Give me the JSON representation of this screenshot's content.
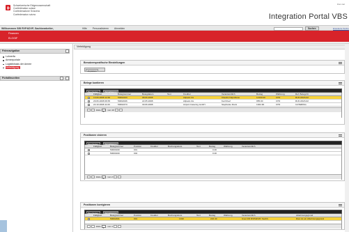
{
  "header": {
    "confederation": [
      "Schweizerische Eidgenossenschaft",
      "Confédération suisse",
      "Confederazione Svizzera",
      "Confederaziun svizra"
    ],
    "toplinks": "Inter-net",
    "portal_title": "Integration Portal VBS"
  },
  "menubar": {
    "welcome": "Willkommen SIB RVP&DVP, Sachbearbeiter,",
    "items": [
      "Hilfe",
      "Personalisieren",
      "Abmelden"
    ],
    "search_button": "Suchen",
    "extended_search": "Erweiterte Suche"
  },
  "tabs": {
    "primary": "Finanzen",
    "secondary": "ELOGIF"
  },
  "left": {
    "nav_header": "Feinnavigation",
    "nav_items": [
      "Lohnerfa",
      "Armeeportale",
      "Logistikbasis der Armee",
      "Verteidigung"
    ],
    "portal_favorites": "Portalfavoriten"
  },
  "main": {
    "title": "Verteidigung",
    "settings_panel": {
      "title": "Benutzerspezifische Einstellungen",
      "button": "Anpassen"
    },
    "belege_panel": {
      "title": "Belege kontieren",
      "toolbar": [
        "Bearbeiten",
        "Aktualisieren"
      ],
      "columns": [
        "Fälligkeit",
        "Belegnummer",
        "Belegdatum",
        "Text",
        "Kreditor",
        "Verantwortlich",
        "Betrag",
        "Währung",
        "Ref. Beleg-Nr."
      ],
      "rows": [
        [
          "13.06.2008 12:30",
          "50002433",
          "08.06.2008",
          "",
          "Allpack AG",
          "Claudio Napolitano",
          "12100.00",
          "CHF",
          "RUK-0623-02"
        ],
        [
          "29.06.2008 08:35",
          "50002026",
          "22.05.2008",
          "",
          "Allpack AG",
          "Karl Ruef",
          "955.00",
          "CHF",
          "RUK-0623-02"
        ],
        [
          "22.10.2008 11:00",
          "50002473",
          "30.06.2008",
          "",
          "Airport-Catering GmbH",
          "Stephanie Fluck",
          "1924.90",
          "CHF",
          "CATERING"
        ]
      ],
      "pager": {
        "label": "Zeile",
        "current": "1",
        "of": "von 10"
      }
    },
    "visieren_panel": {
      "title": "Positionen visieren",
      "toolbar": [
        "Bearbeiten",
        "Aktualisieren"
      ],
      "columns": [
        "Fälligkeit",
        "Belegnummer",
        "Position",
        "Kreditor",
        "Buchungskreis",
        "Text",
        "Betrag",
        "Währung",
        "Verantwortlich"
      ],
      "rows": [
        [
          "",
          "50000160",
          "001",
          "",
          "",
          "",
          "0.00",
          "",
          ""
        ],
        [
          "",
          "50000160",
          "002",
          "",
          "",
          "",
          "0.00",
          "",
          ""
        ]
      ],
      "pager": {
        "label": "Zeile",
        "current": "1",
        "of": "von 2"
      }
    },
    "korrigieren_panel": {
      "title": "Positionen korrigieren",
      "toolbar": [
        "Bearbeiten",
        "Aktualisieren"
      ],
      "columns": [
        "Fälligkeit",
        "Belegnummer",
        "Position",
        "Kreditor",
        "Buchungskreis",
        "Text",
        "Betrag",
        "Währung",
        "Verantwortlich",
        "Ablehnungsgrund"
      ],
      "rows": [
        [
          "",
          "50002461",
          "001",
          "",
          "1010",
          "",
          "222.40",
          "",
          "User-DD RVP&DVP, Sachb.",
          "Dies ist ein Ablehnungsgrund"
        ]
      ],
      "pager": {
        "label": "Zeile",
        "current": "1",
        "of": "von 1"
      }
    }
  },
  "colors": {
    "brand_red": "#d8232a",
    "selection": "#f6d23c",
    "toolbar": "#222222"
  }
}
